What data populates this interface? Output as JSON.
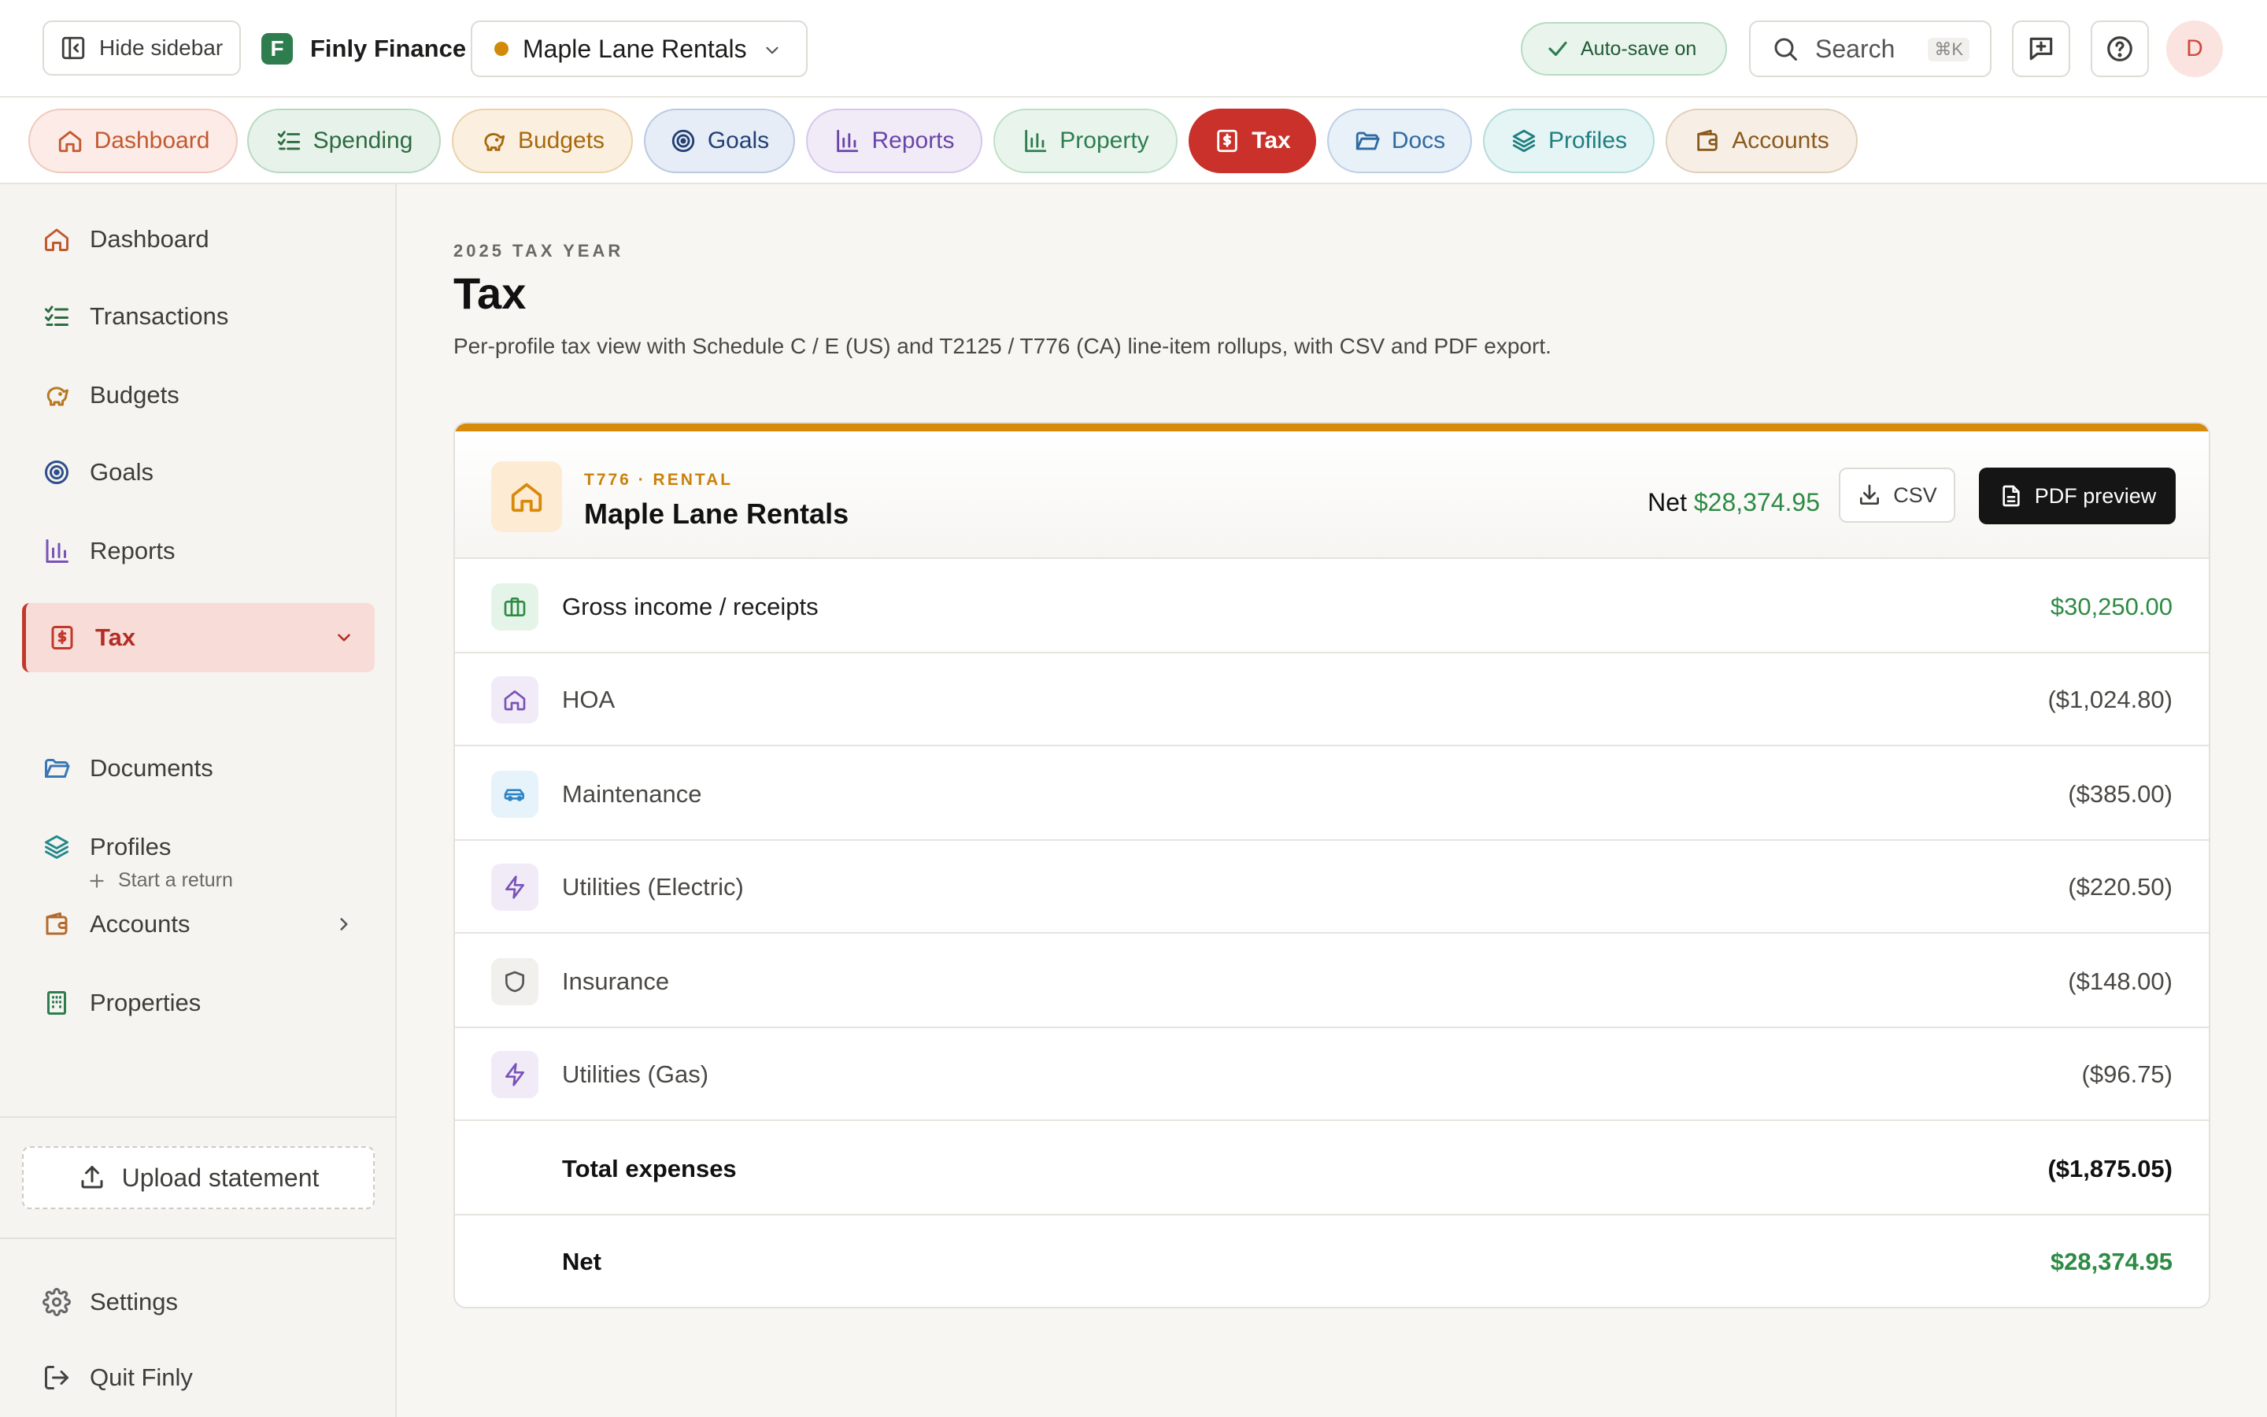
{
  "app": {
    "hide_sidebar": "Hide sidebar",
    "brand_letter": "F",
    "brand_name": "Finly Finance",
    "active_profile": "Maple Lane Rentals",
    "autosave": "Auto-save on",
    "search_placeholder": "Search",
    "search_shortcut": "⌘K",
    "avatar_initial": "D"
  },
  "tabs": [
    {
      "label": "Dashboard",
      "icon": "home-icon",
      "bg": "#fcebe6",
      "border": "#f0c9bd",
      "color": "#c25a30"
    },
    {
      "label": "Spending",
      "icon": "list-check-icon",
      "bg": "#e7f3ea",
      "border": "#b8d9c1",
      "color": "#2e6b41"
    },
    {
      "label": "Budgets",
      "icon": "piggy-bank-icon",
      "bg": "#fbf0e0",
      "border": "#ead2ab",
      "color": "#a8680c"
    },
    {
      "label": "Goals",
      "icon": "target-icon",
      "bg": "#e6edf7",
      "border": "#b9c9e2",
      "color": "#223f73"
    },
    {
      "label": "Reports",
      "icon": "bar-chart-icon",
      "bg": "#f1ebf8",
      "border": "#d6c7ec",
      "color": "#6a45a8"
    },
    {
      "label": "Property",
      "icon": "bar-chart-icon",
      "bg": "#e9f5ec",
      "border": "#bfe0c8",
      "color": "#2e7d4f"
    },
    {
      "label": "Tax",
      "icon": "tax-doc-icon",
      "bg": "#c9312a",
      "border": "#c9312a",
      "color": "#ffffff"
    },
    {
      "label": "Docs",
      "icon": "folder-icon",
      "bg": "#e8f0f8",
      "border": "#bdd0e6",
      "color": "#2f6aa3"
    },
    {
      "label": "Profiles",
      "icon": "layers-icon",
      "bg": "#e5f4f4",
      "border": "#b4dcdc",
      "color": "#1f7f80"
    },
    {
      "label": "Accounts",
      "icon": "wallet-icon",
      "bg": "#f7efe6",
      "border": "#e0cfb9",
      "color": "#8a5a1c"
    }
  ],
  "sidebar": {
    "items": [
      {
        "label": "Dashboard",
        "icon": "home-icon",
        "color": "#c25a30"
      },
      {
        "label": "Transactions",
        "icon": "list-check-icon",
        "color": "#2e6b41"
      },
      {
        "label": "Budgets",
        "icon": "piggy-bank-icon",
        "color": "#b7791f"
      },
      {
        "label": "Goals",
        "icon": "target-icon",
        "color": "#2f4f8a"
      },
      {
        "label": "Reports",
        "icon": "bar-chart-icon",
        "color": "#7a52b8"
      },
      {
        "label": "Tax",
        "icon": "tax-doc-icon",
        "color": "#c0392b",
        "active": true
      },
      {
        "label": "Documents",
        "icon": "folder-icon",
        "color": "#3a77b5"
      },
      {
        "label": "Profiles",
        "icon": "layers-icon",
        "color": "#23898a"
      },
      {
        "label": "Accounts",
        "icon": "wallet-icon",
        "color": "#b56a2c"
      },
      {
        "label": "Properties",
        "icon": "building-icon",
        "color": "#2e7d4f"
      }
    ],
    "sub_item": "Start a return",
    "upload": "Upload statement",
    "settings": "Settings",
    "quit": "Quit Finly"
  },
  "page": {
    "kicker": "2025 TAX YEAR",
    "title": "Tax",
    "description": "Per-profile tax view with Schedule C / E (US) and T2125 / T776 (CA) line-item rollups, with CSV and PDF export."
  },
  "card": {
    "accent_color": "#d88a0b",
    "kicker": "T776 · RENTAL",
    "title": "Maple Lane Rentals",
    "net_label": "Net",
    "net_value": "$28,374.95",
    "csv_label": "CSV",
    "pdf_label": "PDF preview",
    "rows": [
      {
        "kind": "income",
        "label": "Gross income / receipts",
        "amount": "$30,250.00",
        "icon": "briefcase-icon",
        "icon_bg": "#e5f4e8",
        "icon_color": "#2e8b45"
      },
      {
        "kind": "expense",
        "label": "HOA",
        "amount": "($1,024.80)",
        "icon": "home-icon",
        "icon_bg": "#f1ebf8",
        "icon_color": "#7a52b8"
      },
      {
        "kind": "expense",
        "label": "Maintenance",
        "amount": "($385.00)",
        "icon": "car-icon",
        "icon_bg": "#e6f3fb",
        "icon_color": "#2f86c4"
      },
      {
        "kind": "expense",
        "label": "Utilities (Electric)",
        "amount": "($220.50)",
        "icon": "bolt-icon",
        "icon_bg": "#f1ebf8",
        "icon_color": "#7a52b8"
      },
      {
        "kind": "expense",
        "label": "Insurance",
        "amount": "($148.00)",
        "icon": "shield-icon",
        "icon_bg": "#f1f0ec",
        "icon_color": "#555"
      },
      {
        "kind": "expense",
        "label": "Utilities (Gas)",
        "amount": "($96.75)",
        "icon": "bolt-icon",
        "icon_bg": "#f1ebf8",
        "icon_color": "#7a52b8"
      },
      {
        "kind": "total",
        "label": "Total expenses",
        "amount": "($1,875.05)"
      },
      {
        "kind": "net",
        "label": "Net",
        "amount": "$28,374.95"
      }
    ]
  }
}
